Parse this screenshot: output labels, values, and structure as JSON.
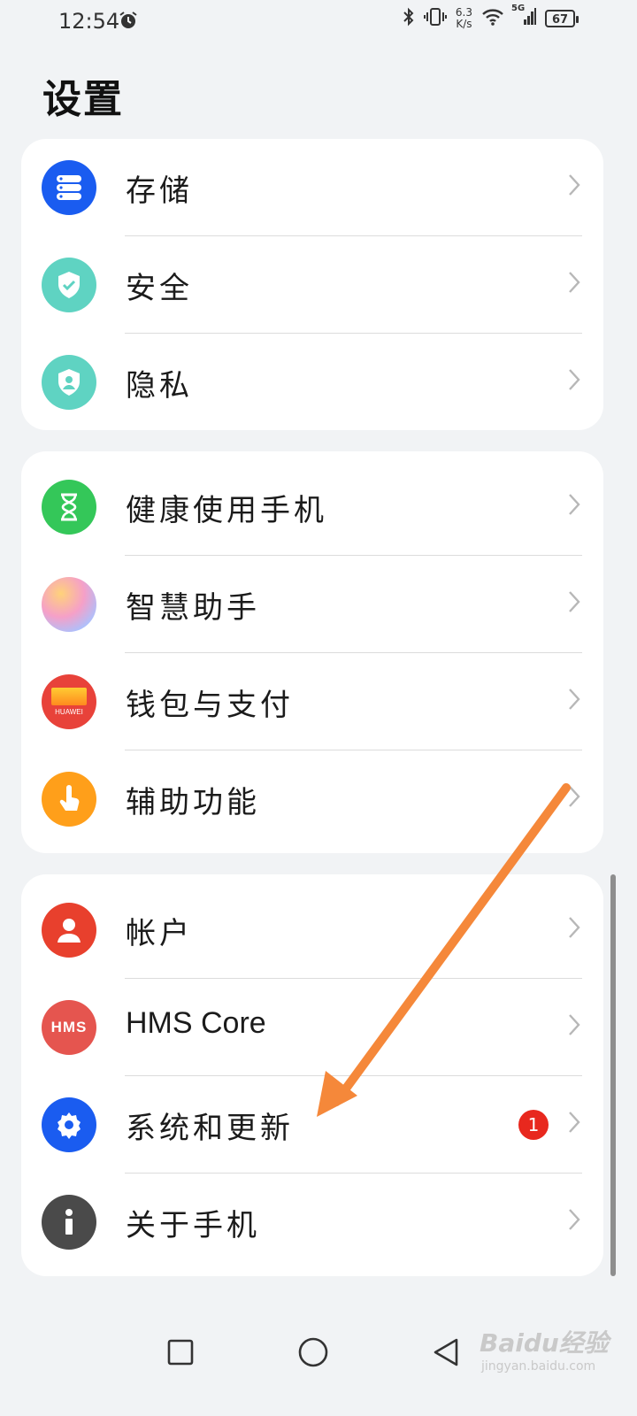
{
  "status_bar": {
    "time": "12:54",
    "net_speed_value": "6.3",
    "net_speed_unit": "K/s",
    "signal_label": "5G",
    "battery": "67"
  },
  "page": {
    "title": "设置"
  },
  "groups": [
    {
      "items": [
        {
          "label": "存储",
          "icon": "storage-icon",
          "color": "#1a5cf0"
        },
        {
          "label": "安全",
          "icon": "security-shield-icon",
          "color": "#5fd3c2"
        },
        {
          "label": "隐私",
          "icon": "privacy-shield-icon",
          "color": "#5fd3c2"
        }
      ]
    },
    {
      "items": [
        {
          "label": "健康使用手机",
          "icon": "hourglass-icon",
          "color": "#34c759"
        },
        {
          "label": "智慧助手",
          "icon": "assistant-orb-icon",
          "color": "#e4a6e8"
        },
        {
          "label": "钱包与支付",
          "icon": "wallet-icon",
          "color": "#e8423a",
          "icon_text": "HUAWEI"
        },
        {
          "label": "辅助功能",
          "icon": "touch-hand-icon",
          "color": "#ff9f1a"
        }
      ]
    },
    {
      "items": [
        {
          "label": "帐户",
          "icon": "account-icon",
          "color": "#e8402d"
        },
        {
          "label": "HMS Core",
          "icon": "hms-icon",
          "color": "#e5554f",
          "icon_text": "HMS"
        },
        {
          "label": "系统和更新",
          "icon": "gear-icon",
          "color": "#1a5cf0",
          "badge": "1"
        },
        {
          "label": "关于手机",
          "icon": "info-icon",
          "color": "#4a4a4a"
        }
      ]
    }
  ],
  "nav": {
    "recents": "recents",
    "home": "home",
    "back": "back"
  },
  "watermark": {
    "main": "Baidu经验",
    "sub": "jingyan.baidu.com"
  }
}
